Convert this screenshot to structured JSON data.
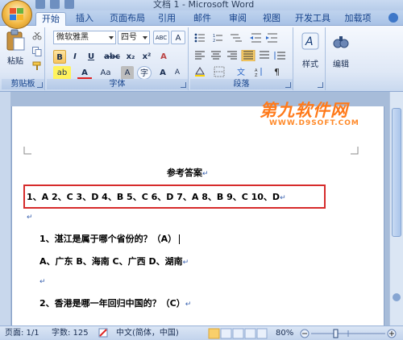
{
  "window": {
    "title": "文档 1 - Microsoft Word"
  },
  "tabs": [
    {
      "label": "开始",
      "active": true
    },
    {
      "label": "插入",
      "active": false
    },
    {
      "label": "页面布局",
      "active": false
    },
    {
      "label": "引用",
      "active": false
    },
    {
      "label": "邮件",
      "active": false
    },
    {
      "label": "审阅",
      "active": false
    },
    {
      "label": "视图",
      "active": false
    },
    {
      "label": "开发工具",
      "active": false
    },
    {
      "label": "加载项",
      "active": false
    }
  ],
  "ribbon": {
    "clipboard": {
      "label": "剪贴板",
      "paste_label": "粘贴"
    },
    "font": {
      "label": "字体",
      "font_name": "微软雅黑",
      "font_size": "四号",
      "phonetic_glyph": "ABC",
      "char_border_glyph": "A",
      "bold": "B",
      "italic": "I",
      "underline": "U",
      "strike": "abc",
      "subscript": "x₂",
      "superscript": "x²",
      "clear_format": "A",
      "highlight": "ab",
      "font_color": "A",
      "change_case": "Aa",
      "char_shading": "A",
      "enclose_char": "字",
      "grow_font": "A",
      "shrink_font": "A"
    },
    "paragraph": {
      "label": "段落"
    },
    "styles": {
      "label": "样式"
    },
    "editing": {
      "label": "编辑"
    }
  },
  "watermark": {
    "title": "第九软件网",
    "url": "WWW.D9SOFT.COM"
  },
  "document": {
    "heading": "参考答案",
    "answers": "1、A   2、C   3、D   4、B   5、C   6、D   7、A   8、B   9、C   10、D",
    "q1": "1、湛江是属于哪个省份的？（A）",
    "q1_options": "A、广东    B、海南    C、广西    D、湖南",
    "q2": "2、香港是哪一年回归中国的？（C）",
    "para_mark": "↵"
  },
  "status": {
    "page": "页面: 1/1",
    "words": "字数: 125",
    "language": "中文(简体，中国)",
    "zoom": "80%"
  },
  "colors": {
    "highlight_box": "#d62b2b",
    "watermark": "#ff7a1a"
  }
}
